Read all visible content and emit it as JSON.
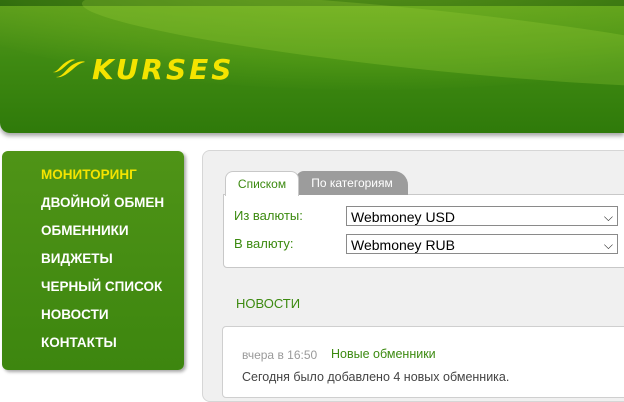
{
  "header": {
    "logo_text": "KURSES"
  },
  "sidebar": {
    "items": [
      {
        "label": "МОНИТОРИНГ",
        "active": true
      },
      {
        "label": "ДВОЙНОЙ ОБМЕН"
      },
      {
        "label": "ОБМЕННИКИ"
      },
      {
        "label": "ВИДЖЕТЫ"
      },
      {
        "label": "ЧЕРНЫЙ СПИСОК"
      },
      {
        "label": "НОВОСТИ"
      },
      {
        "label": "КОНТАКТЫ"
      }
    ]
  },
  "tabs": [
    {
      "label": "Списком",
      "active": true
    },
    {
      "label": "По категориям"
    }
  ],
  "filter": {
    "from_label": "Из валюты:",
    "from_value": "Webmoney USD",
    "to_label": "В валюту:",
    "to_value": "Webmoney RUB"
  },
  "news": {
    "title": "НОВОСТИ",
    "items": [
      {
        "date": "вчера в 16:50",
        "title": "Новые обменники",
        "text": "Сегодня было добавлено 4 новых обменника."
      }
    ]
  },
  "colors": {
    "brand_green": "#3d860f",
    "accent_yellow": "#f4e400",
    "link_green": "#3c8a10",
    "tab_inactive": "#9c9c9c"
  }
}
